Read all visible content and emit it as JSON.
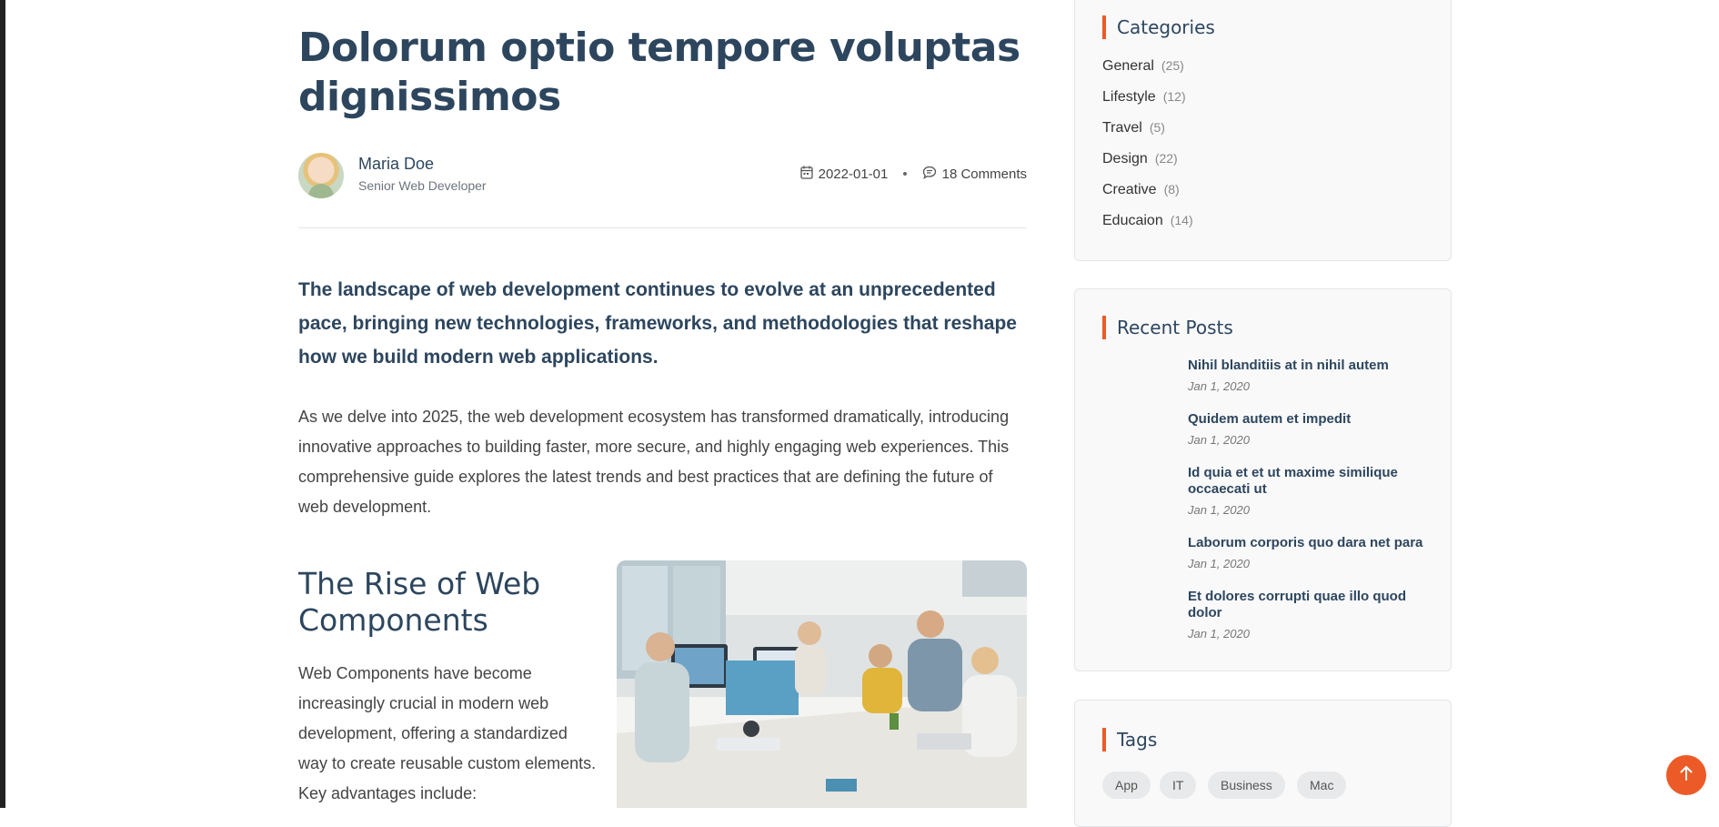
{
  "post": {
    "title": "Dolorum optio tempore voluptas dignissimos",
    "author_name": "Maria Doe",
    "author_role": "Senior Web Developer",
    "date": "2022-01-01",
    "comments": "18 Comments",
    "lead": "The landscape of web development continues to evolve at an unprecedented pace, bringing new technologies, frameworks, and methodologies that reshape how we build modern web applications.",
    "paragraph": "As we delve into 2025, the web development ecosystem has transformed dramatically, introducing innovative approaches to building faster, more secure, and highly engaging web experiences. This comprehensive guide explores the latest trends and best practices that are defining the future of web development.",
    "section_title": "The Rise of Web Components",
    "section_paragraph": "Web Components have become increasingly crucial in modern web development, offering a standardized way to create reusable custom elements. Key advantages include:"
  },
  "sidebar": {
    "categories_title": "Categories",
    "categories": [
      {
        "name": "General",
        "count": "(25)"
      },
      {
        "name": "Lifestyle",
        "count": "(12)"
      },
      {
        "name": "Travel",
        "count": "(5)"
      },
      {
        "name": "Design",
        "count": "(22)"
      },
      {
        "name": "Creative",
        "count": "(8)"
      },
      {
        "name": "Educaion",
        "count": "(14)"
      }
    ],
    "recent_title": "Recent Posts",
    "recent_posts": [
      {
        "title": "Nihil blanditiis at in nihil autem",
        "date": "Jan 1, 2020"
      },
      {
        "title": "Quidem autem et impedit",
        "date": "Jan 1, 2020"
      },
      {
        "title": "Id quia et et ut maxime similique occaecati ut",
        "date": "Jan 1, 2020"
      },
      {
        "title": "Laborum corporis quo dara net para",
        "date": "Jan 1, 2020"
      },
      {
        "title": "Et dolores corrupti quae illo quod dolor",
        "date": "Jan 1, 2020"
      }
    ],
    "tags_title": "Tags",
    "tags": [
      "App",
      "IT",
      "Business",
      "Mac"
    ]
  },
  "colors": {
    "accent": "#ec5b27",
    "heading": "#2d465e"
  },
  "icons": {
    "date": "calendar-icon",
    "comments": "chat-icon",
    "scroll_top": "arrow-up-icon"
  }
}
